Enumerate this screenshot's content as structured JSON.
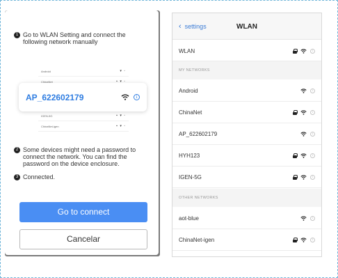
{
  "instructions": {
    "step1": "Go to WLAN Setting and connect the following network manually",
    "step2": "Some devices might need a password to connect the network. You can find the password on the device enclosure.",
    "step3": "Connected.",
    "numbers": [
      "1",
      "2",
      "3"
    ]
  },
  "mini_list_top": [
    {
      "label": "Android",
      "icons": "▾ ◦"
    },
    {
      "label": "ChinaNet",
      "icons": "▪ ▾ ◦"
    }
  ],
  "mini_list_bottom": [
    {
      "label": "IGEN-5G",
      "icons": "▪ ▾ ◦"
    },
    {
      "label": "ChinaNet-igen",
      "icons": "▪ ▾ ◦"
    }
  ],
  "highlight": {
    "ssid": "AP_622602179",
    "info_glyph": "i"
  },
  "buttons": {
    "connect": "Go to connect",
    "cancel": "Cancelar"
  },
  "wlan": {
    "back_label": "settings",
    "title": "WLAN",
    "toggle_row": "WLAN",
    "my_networks_header": "MY NETWORKS",
    "my_networks": [
      {
        "name": "Android",
        "locked": false
      },
      {
        "name": "ChinaNet",
        "locked": true
      },
      {
        "name": "AP_622602179",
        "locked": false
      },
      {
        "name": "HYH123",
        "locked": true
      },
      {
        "name": "IGEN-5G",
        "locked": true
      }
    ],
    "other_networks_header": "OTHER NETWORKS",
    "other_networks": [
      {
        "name": "aot-blue",
        "locked": false
      },
      {
        "name": "ChinaNet-igen",
        "locked": true
      }
    ],
    "info_glyph": "i"
  },
  "colors": {
    "accent": "#4a8ef3",
    "ssid": "#2f7de1",
    "link": "#3a7bd5"
  }
}
